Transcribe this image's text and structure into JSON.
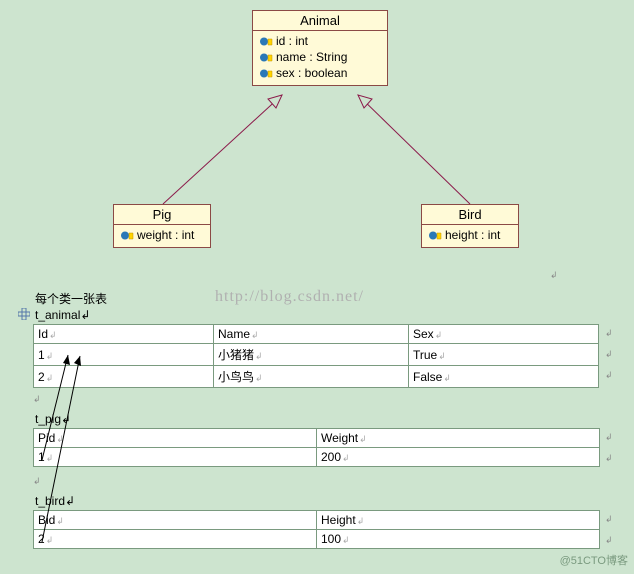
{
  "classes": {
    "animal": {
      "name": "Animal",
      "attrs": [
        "id : int",
        "name : String",
        "sex : boolean"
      ]
    },
    "pig": {
      "name": "Pig",
      "attrs": [
        "weight : int"
      ]
    },
    "bird": {
      "name": "Bird",
      "attrs": [
        "height : int"
      ]
    }
  },
  "watermark": "http://blog.csdn.net/",
  "corner_watermark": "@51CTO博客",
  "section_label": "每个类一张表",
  "tables": {
    "t_animal": {
      "caption": "t_animal",
      "headers": [
        "Id",
        "Name",
        "Sex"
      ],
      "rows": [
        [
          "1",
          "小猪猪",
          "True"
        ],
        [
          "2",
          "小鸟鸟",
          "False"
        ]
      ]
    },
    "t_pig": {
      "caption": "t_pig",
      "headers": [
        "Pid",
        "Weight"
      ],
      "rows": [
        [
          "1",
          "200"
        ]
      ]
    },
    "t_bird": {
      "caption": "t_bird",
      "headers": [
        "Bid",
        "Height"
      ],
      "rows": [
        [
          "2",
          "100"
        ]
      ]
    }
  }
}
